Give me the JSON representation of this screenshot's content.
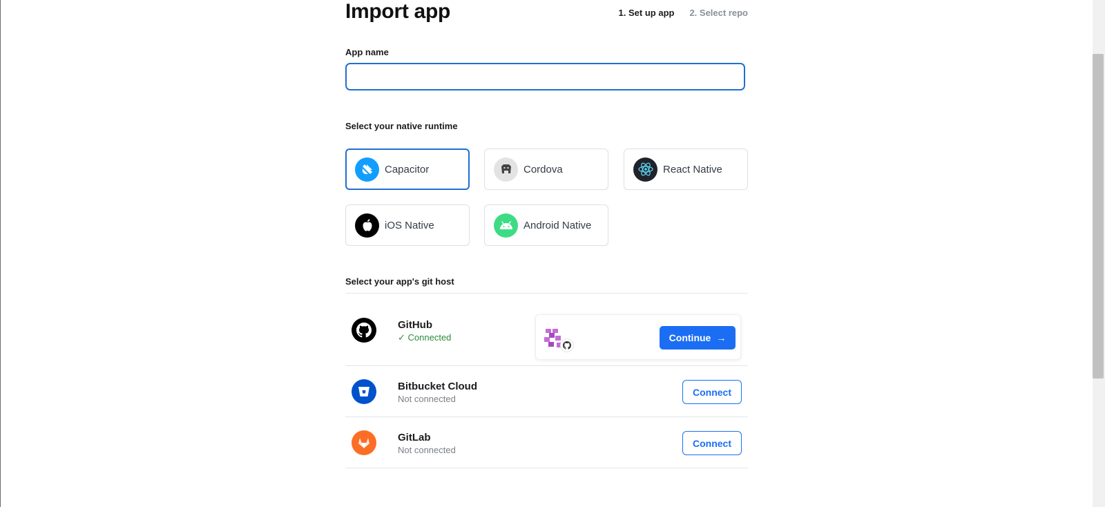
{
  "header": {
    "title": "Import app",
    "steps": [
      "1. Set up app",
      "2. Select repo"
    ]
  },
  "app_name": {
    "label": "App name",
    "value": "",
    "placeholder": ""
  },
  "runtime": {
    "label": "Select your native runtime",
    "selected": "Capacitor",
    "options": [
      {
        "label": "Capacitor",
        "icon": "capacitor-icon"
      },
      {
        "label": "Cordova",
        "icon": "cordova-icon"
      },
      {
        "label": "React Native",
        "icon": "react-icon"
      },
      {
        "label": "iOS Native",
        "icon": "apple-icon"
      },
      {
        "label": "Android Native",
        "icon": "android-icon"
      }
    ]
  },
  "git_host": {
    "label": "Select your app's git host",
    "hosts": [
      {
        "name": "GitHub",
        "status": "Connected",
        "icon": "github-icon",
        "action": "Continue"
      },
      {
        "name": "Bitbucket Cloud",
        "status": "Not connected",
        "icon": "bitbucket-icon",
        "action": "Connect"
      },
      {
        "name": "GitLab",
        "status": "Not connected",
        "icon": "gitlab-icon",
        "action": "Connect"
      }
    ]
  },
  "colors": {
    "accent": "#1b6ef3",
    "connected": "#2e8b3a",
    "capacitor": "#119eff",
    "android": "#3ddc84",
    "bitbucket": "#0052cc",
    "gitlab": "#fc6d26"
  }
}
